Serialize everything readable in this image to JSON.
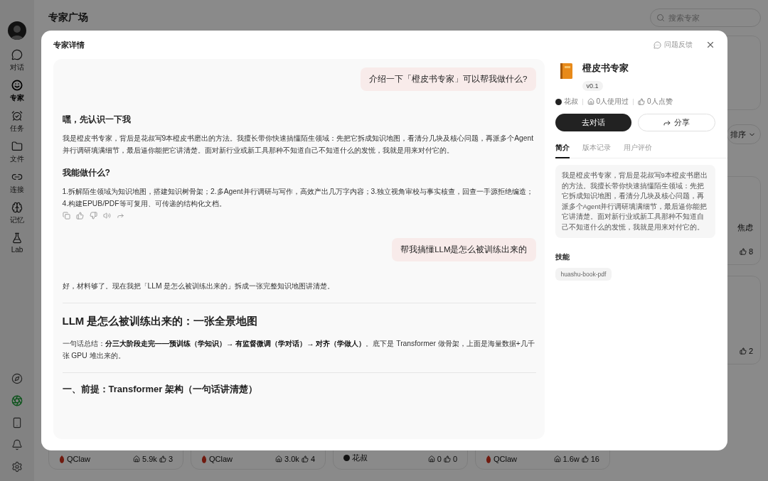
{
  "sidebar": {
    "items": [
      {
        "label": "对话",
        "selected": false
      },
      {
        "label": "专家",
        "selected": true
      },
      {
        "label": "任务",
        "selected": false
      },
      {
        "label": "文件",
        "selected": false
      },
      {
        "label": "连接",
        "selected": false
      },
      {
        "label": "记忆",
        "selected": false
      },
      {
        "label": "Lab",
        "selected": false
      }
    ],
    "tools": [
      {
        "kind": "compass",
        "active": false
      },
      {
        "kind": "spark",
        "active": true
      },
      {
        "kind": "phone",
        "active": false
      },
      {
        "kind": "bell",
        "active": false
      },
      {
        "kind": "settings",
        "active": false
      }
    ]
  },
  "page": {
    "title": "专家广场",
    "search": {
      "placeholder": "搜索专家"
    },
    "sort_label": "排序",
    "side_cards": [
      {
        "text": "焦虑",
        "likes": "8"
      },
      {
        "likes": "2"
      }
    ],
    "bottom_cards": [
      {
        "author": "QClaw",
        "kind": "claw",
        "uses": "5.9k",
        "likes": "3"
      },
      {
        "author": "QClaw",
        "kind": "claw",
        "uses": "3.0k",
        "likes": "4"
      },
      {
        "author": "花叔",
        "kind": "person",
        "uses": "0",
        "likes": "0"
      },
      {
        "author": "QClaw",
        "kind": "claw",
        "uses": "1.6w",
        "likes": "16"
      }
    ]
  },
  "modal": {
    "title": "专家详情",
    "feedback": "问题反馈",
    "messages": [
      {
        "kind": "user",
        "text": "介绍一下「橙皮书专家」可以帮我做什么?"
      },
      {
        "kind": "assistant",
        "blocks": [
          {
            "kind": "heading",
            "text": "嘿，先认识一下我"
          },
          {
            "kind": "paragraph",
            "text": "我是橙皮书专家，背后是花叔写9本橙皮书磨出的方法。我擅长带你快速搞懂陌生领域：先把它拆成知识地图，看清分几块及核心问题，再派多个Agent并行调研填满细节，最后逼你能把它讲清楚。面对新行业或新工具那种不知道自己不知道什么的发慌，我就是用来对付它的。"
          },
          {
            "kind": "heading",
            "text": "我能做什么?"
          },
          {
            "kind": "paragraph",
            "text": "1.拆解陌生领域为知识地图，搭建知识树骨架；2.多Agent并行调研与写作，高效产出几万字内容；3.独立视角审校与事实核查，回查一手源拒绝编造；4.构建EPUB/PDF等可复用、可传递的结构化文档。"
          },
          {
            "kind": "actions"
          }
        ]
      },
      {
        "kind": "user",
        "text": "帮我搞懂LLM是怎么被训练出来的"
      },
      {
        "kind": "assistant",
        "blocks": [
          {
            "kind": "paragraph",
            "text": "好，材料够了。现在我把「LLM 是怎么被训练出来的」拆成一张完整知识地图讲清楚。"
          },
          {
            "kind": "divider"
          },
          {
            "kind": "title",
            "text": "LLM 是怎么被训练出来的：一张全景地图"
          },
          {
            "kind": "paragraph",
            "text": "一句话总结：**分三大阶段走完——预训练（学知识）→ 有监督微调（学对话）→ 对齐（学做人）**。底下是 Transformer 做骨架，上面是海量数据+几千张 GPU 堆出来的。"
          },
          {
            "kind": "divider"
          },
          {
            "kind": "heading_large",
            "text": "一、前提：Transformer 架构（一句话讲清楚）"
          }
        ]
      }
    ],
    "expert": {
      "name": "橙皮书专家",
      "version": "v0.1",
      "author": "花叔",
      "uses": "0人使用过",
      "likes": "0人点赞",
      "chat_button": "去对话",
      "share_button": "分享",
      "tabs": [
        {
          "label": "简介",
          "selected": true
        },
        {
          "label": "版本记录",
          "selected": false
        },
        {
          "label": "用户评价",
          "selected": false
        }
      ],
      "description": "我是橙皮书专家，背后是花叔写9本橙皮书磨出的方法。我擅长带你快速搞懂陌生领域：先把它拆成知识地图，看清分几块及核心问题，再派多个Agent并行调研填满细节，最后逼你能把它讲清楚。面对新行业或新工具那种不知道自己不知道什么的发慌，我就是用来对付它的。",
      "skills_title": "技能",
      "skills": [
        "huashu-book-pdf"
      ]
    }
  }
}
